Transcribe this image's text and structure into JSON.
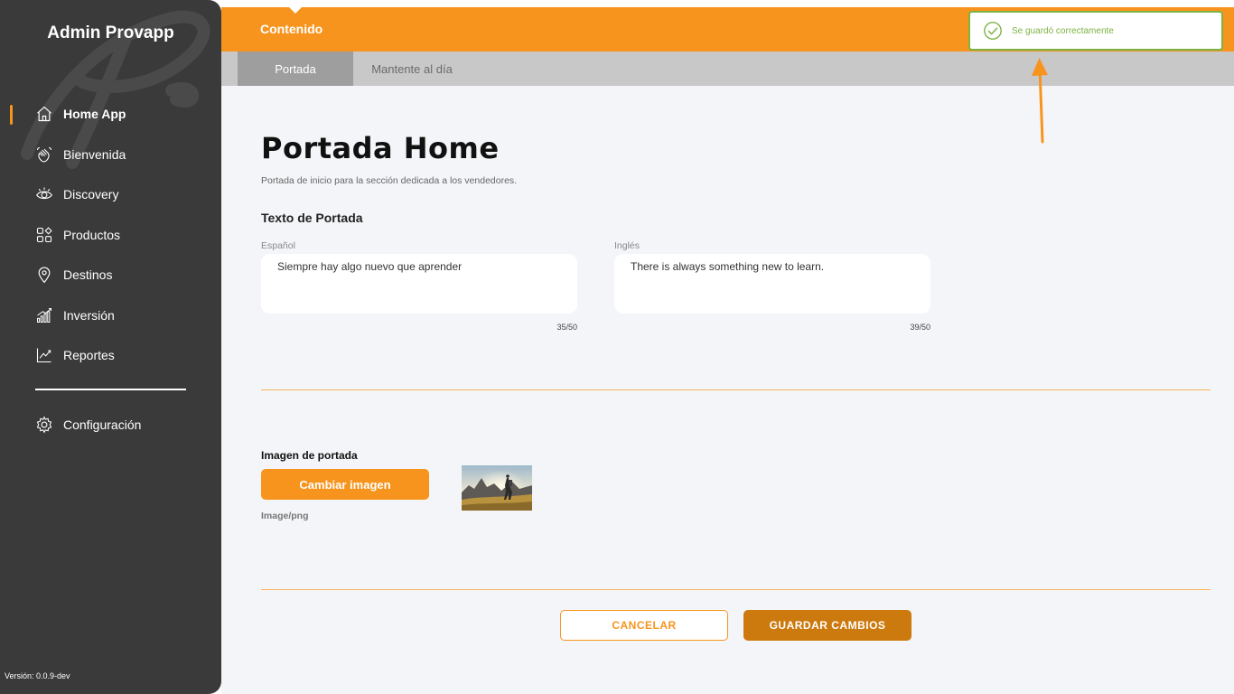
{
  "sidebar": {
    "brand": "Admin Provapp",
    "items": [
      {
        "label": "Home App",
        "icon": "home-icon",
        "active": true
      },
      {
        "label": "Bienvenida",
        "icon": "waving-hand-icon",
        "active": false
      },
      {
        "label": "Discovery",
        "icon": "eye-icon",
        "active": false
      },
      {
        "label": "Productos",
        "icon": "grid-icon",
        "active": false
      },
      {
        "label": "Destinos",
        "icon": "location-pin-icon",
        "active": false
      },
      {
        "label": "Inversión",
        "icon": "bar-growth-icon",
        "active": false
      },
      {
        "label": "Reportes",
        "icon": "line-chart-icon",
        "active": false
      }
    ],
    "config": {
      "label": "Configuración",
      "icon": "gear-icon"
    },
    "version": "Versión: 0.0.9-dev"
  },
  "topbar": {
    "title": "Contenido"
  },
  "tabs": [
    {
      "label": "Portada",
      "active": true
    },
    {
      "label": "Mantente al día",
      "active": false
    }
  ],
  "page": {
    "title": "Portada Home",
    "subtitle": "Portada de inicio para la sección dedicada a los vendedores.",
    "section_title": "Texto de Portada"
  },
  "fields": {
    "spanish": {
      "label": "Español",
      "value": "Siempre hay algo nuevo que aprender",
      "counter": "35/50"
    },
    "english": {
      "label": "Inglés",
      "value": "There is always something new to learn.",
      "counter": "39/50"
    }
  },
  "image": {
    "label": "Imagen de portada",
    "button": "Cambiar imagen",
    "format": "Image/png"
  },
  "actions": {
    "cancel": "CANCELAR",
    "save": "GUARDAR CAMBIOS"
  },
  "toast": {
    "message": "Se guardó correctamente",
    "icon": "check-circle-icon",
    "color": "#7cb342"
  },
  "colors": {
    "accent": "#f7941d",
    "sidebar": "#3a3a3a",
    "save_button": "#cc7a0e"
  }
}
